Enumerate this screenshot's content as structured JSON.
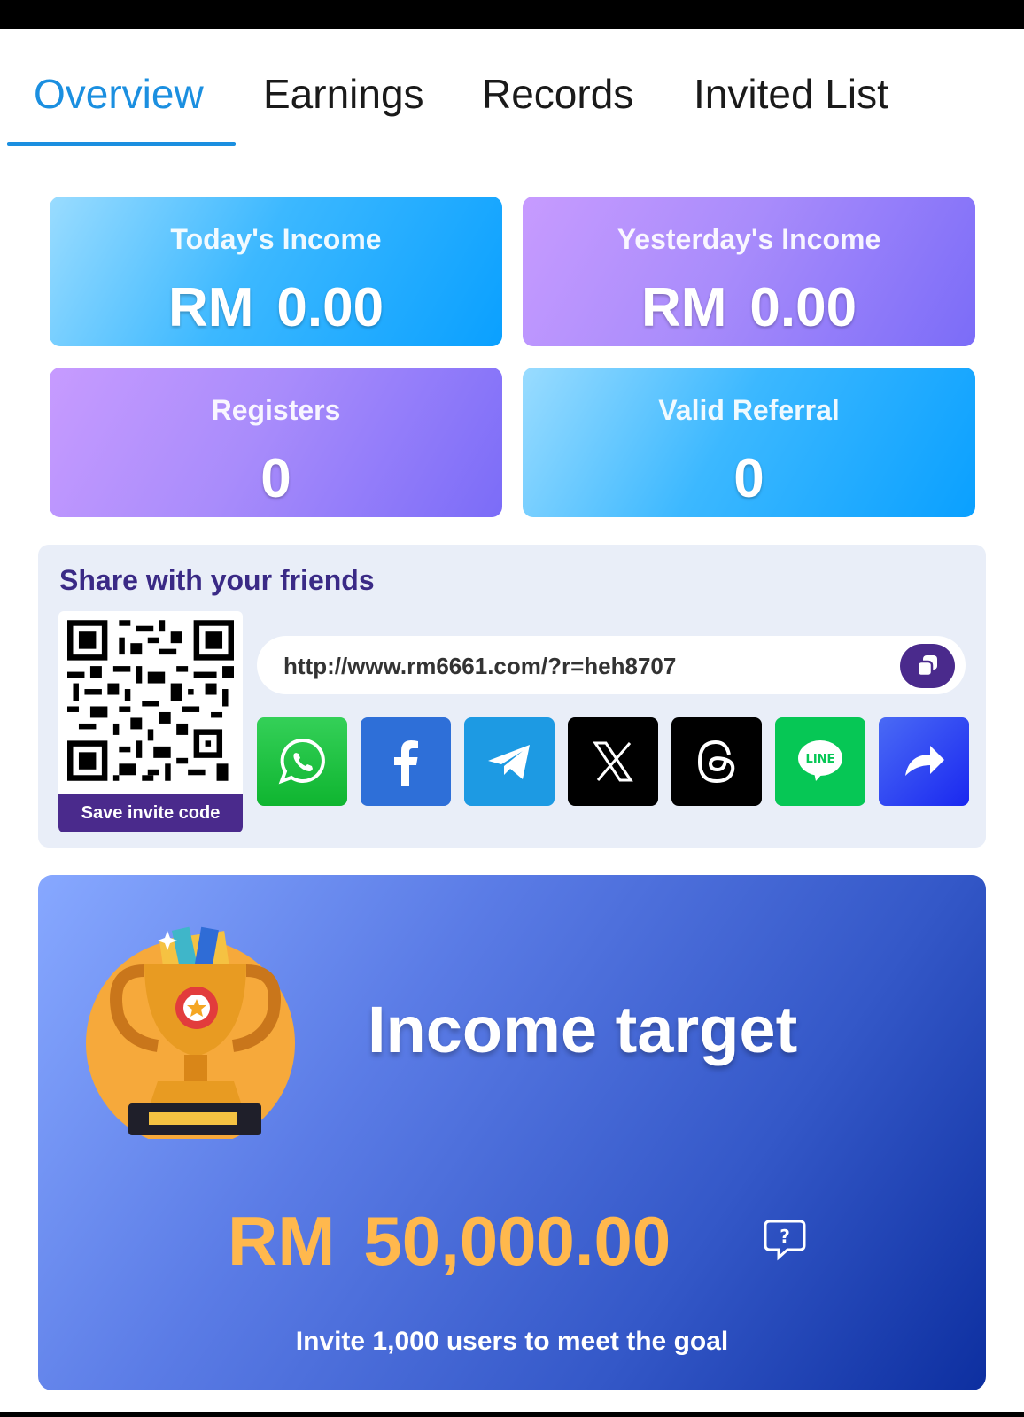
{
  "tabs": [
    {
      "label": "Overview",
      "active": true
    },
    {
      "label": "Earnings",
      "active": false
    },
    {
      "label": "Records",
      "active": false
    },
    {
      "label": "Invited List",
      "active": false
    }
  ],
  "stats": {
    "today": {
      "label": "Today's Income",
      "currency": "RM",
      "value": "0.00"
    },
    "yesterday": {
      "label": "Yesterday's Income",
      "currency": "RM",
      "value": "0.00"
    },
    "registers": {
      "label": "Registers",
      "value": "0"
    },
    "valid_referral": {
      "label": "Valid Referral",
      "value": "0"
    }
  },
  "share": {
    "title": "Share with your friends",
    "save_code_label": "Save invite code",
    "link": "http://www.rm6661.com/?r=heh8707",
    "socials": [
      {
        "icon": "whatsapp-icon",
        "color": "#25c13f"
      },
      {
        "icon": "facebook-icon",
        "color": "#2e6fd8"
      },
      {
        "icon": "telegram-icon",
        "color": "#1d9ae3"
      },
      {
        "icon": "x-icon",
        "color": "#000000"
      },
      {
        "icon": "threads-icon",
        "color": "#000000"
      },
      {
        "icon": "line-icon",
        "color": "#06c755"
      },
      {
        "icon": "share-icon",
        "color": "#2f47ee"
      }
    ]
  },
  "target": {
    "title": "Income target",
    "currency": "RM",
    "amount": "50,000.00",
    "subtitle": "Invite 1,000 users to meet the goal"
  },
  "colors": {
    "accent": "#1b8fe0",
    "purple_dark": "#4a2a8c",
    "amount": "#ffb84d"
  }
}
